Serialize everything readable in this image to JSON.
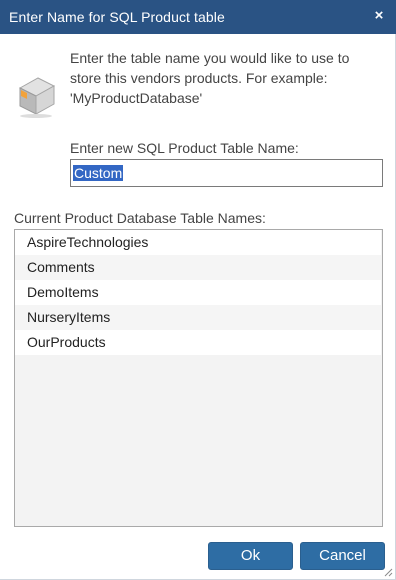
{
  "dialog": {
    "title": "Enter Name for SQL Product table",
    "close_label": "×"
  },
  "intro": {
    "lines": [
      "Enter the table name you would like to use to",
      "store this vendors products. For example:",
      "'MyProductDatabase'"
    ]
  },
  "name_field": {
    "label": "Enter new SQL Product Table Name:",
    "value": "Custom"
  },
  "table_list": {
    "label": "Current Product Database Table Names:",
    "items": [
      "AspireTechnologies",
      "Comments",
      "DemoItems",
      "NurseryItems",
      "OurProducts"
    ]
  },
  "buttons": {
    "ok": "Ok",
    "cancel": "Cancel"
  },
  "colors": {
    "titlebar": "#2a5384",
    "button": "#2e6da4",
    "selection": "#3367c4"
  }
}
